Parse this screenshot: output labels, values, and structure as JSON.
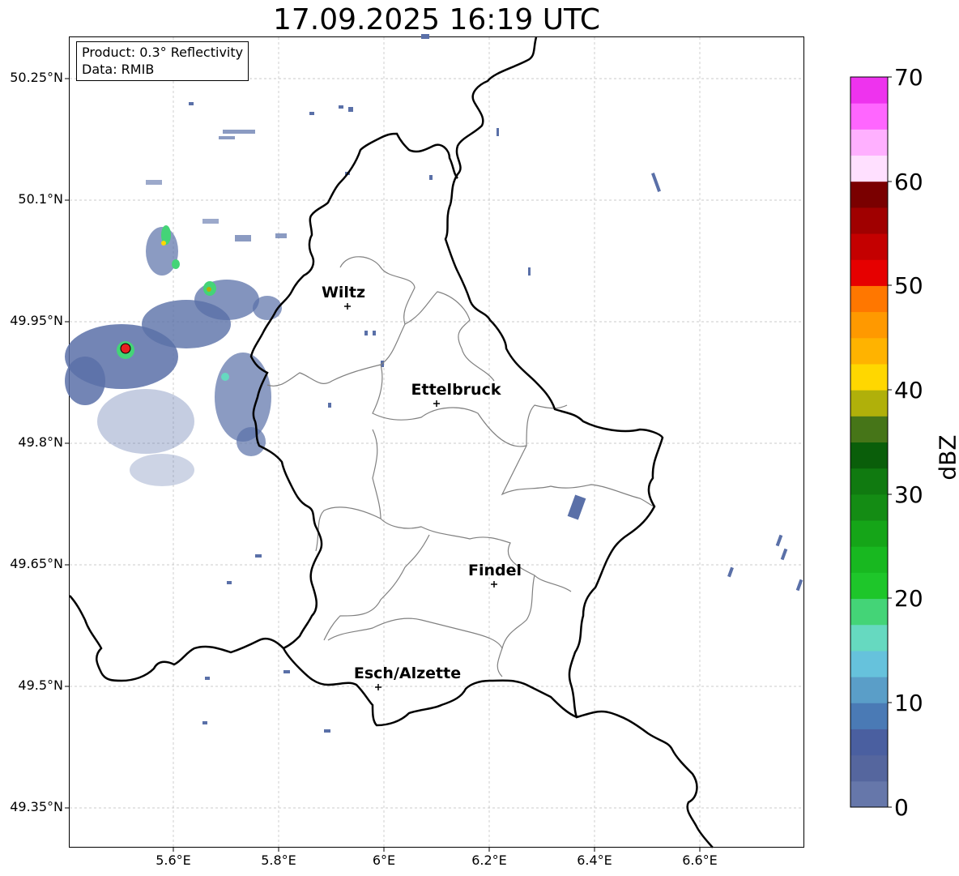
{
  "title": "17.09.2025 16:19 UTC",
  "info": {
    "product": "Product: 0.3° Reflectivity",
    "data": "Data: RMIB"
  },
  "lat_ticks": [
    "50.25°N",
    "50.1°N",
    "49.95°N",
    "49.8°N",
    "49.65°N",
    "49.5°N",
    "49.35°N"
  ],
  "lon_ticks": [
    "5.6°E",
    "5.8°E",
    "6°E",
    "6.2°E",
    "6.4°E",
    "6.6°E"
  ],
  "cities": [
    "Wiltz",
    "Ettelbruck",
    "Findel",
    "Esch/Alzette"
  ],
  "colorbar": {
    "label": "dBZ",
    "ticks": [
      "70",
      "60",
      "50",
      "40",
      "30",
      "20",
      "10",
      "0"
    ],
    "colors_bottom_to_top": [
      "#6677aa",
      "#55669e",
      "#4a5fa0",
      "#4a7ab5",
      "#5a9ec8",
      "#66c2dc",
      "#66d9c0",
      "#44d477",
      "#1ec62a",
      "#18b820",
      "#15a518",
      "#148c14",
      "#107a10",
      "#0a5e0a",
      "#467518",
      "#b0b00a",
      "#ffd700",
      "#ffb300",
      "#ff9900",
      "#ff7700",
      "#e60000",
      "#c40000",
      "#a00000",
      "#7a0000",
      "#ffe0ff",
      "#ffb0ff",
      "#ff66ff",
      "#ee33ee"
    ]
  },
  "radar_marker_color": "#e82020"
}
